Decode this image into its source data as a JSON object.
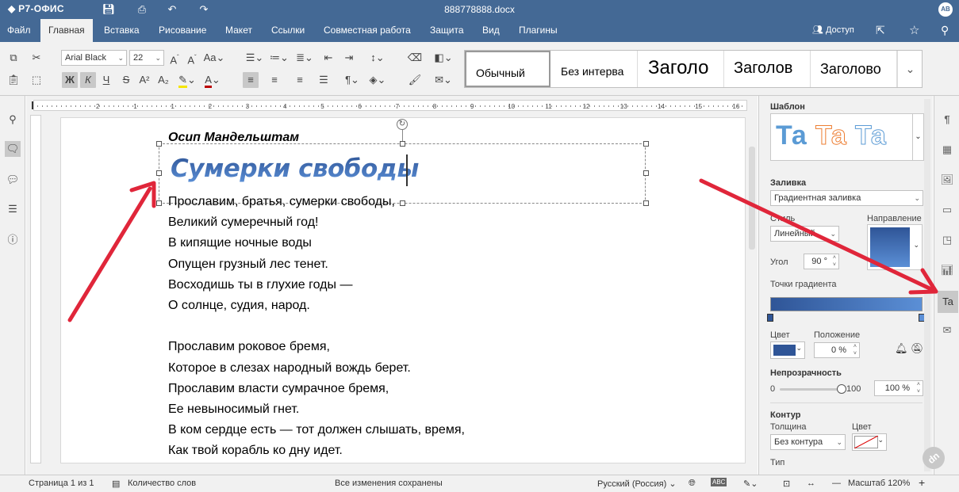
{
  "app": {
    "logo": "Р7-ОФИС",
    "doc_title": "888778888.docx",
    "avatar": "АВ"
  },
  "menu": {
    "items": [
      "Файл",
      "Главная",
      "Вставка",
      "Рисование",
      "Макет",
      "Ссылки",
      "Совместная работа",
      "Защита",
      "Вид",
      "Плагины"
    ],
    "active": "Главная",
    "access": "Доступ"
  },
  "toolbar": {
    "font_name": "Arial Black",
    "font_size": "22",
    "styles": [
      "Обычный",
      "Без интерва",
      "Заголо",
      "Заголов",
      "Заголово"
    ]
  },
  "document": {
    "author": "Осип Мандельштам",
    "title": "Сумерки свободы",
    "poem": "Прославим, братья, сумерки свободы,\nВеликий сумеречный год!\nВ кипящие ночные воды\nОпущен грузный лес тенет.\nВосходишь ты в глухие годы —\nО солнце, судия, народ.\n\nПрославим роковое бремя,\nКоторое в слезах народный вождь берет.\nПрославим власти сумрачное бремя,\nЕе невыносимый гнет.\nВ ком сердце есть — тот должен слышать, время,\nКак твой корабль ко дну идет."
  },
  "ruler": {
    "h_ticks": [
      "2",
      "1",
      "1",
      "2",
      "3",
      "4",
      "5",
      "6",
      "7",
      "8",
      "9",
      "10",
      "11",
      "12",
      "13",
      "14",
      "15",
      "16"
    ]
  },
  "right_panel": {
    "template_label": "Шаблон",
    "template_sample": "Та",
    "fill_label": "Заливка",
    "fill_value": "Градиентная заливка",
    "style_label": "Стиль",
    "style_value": "Линейный",
    "direction_label": "Направление",
    "angle_label": "Угол",
    "angle_value": "90 °",
    "gradient_points_label": "Точки градиента",
    "color_label": "Цвет",
    "position_label": "Положение",
    "position_value": "0 %",
    "opacity_label": "Непрозрачность",
    "opacity_min": "0",
    "opacity_max": "100",
    "opacity_value": "100 %",
    "opacity_level": 1.0,
    "contour_label": "Контур",
    "thickness_label": "Толщина",
    "thickness_value": "Без контура",
    "contour_color_label": "Цвет",
    "type_label": "Тип",
    "colors": {
      "gradient_start": "#2f5597",
      "gradient_end": "#5b8fd6",
      "accent": "#446995"
    }
  },
  "status": {
    "page": "Страница 1 из 1",
    "word_count": "Количество слов",
    "saved": "Все изменения сохранены",
    "language": "Русский (Россия)",
    "zoom": "Масштаб 120%"
  }
}
